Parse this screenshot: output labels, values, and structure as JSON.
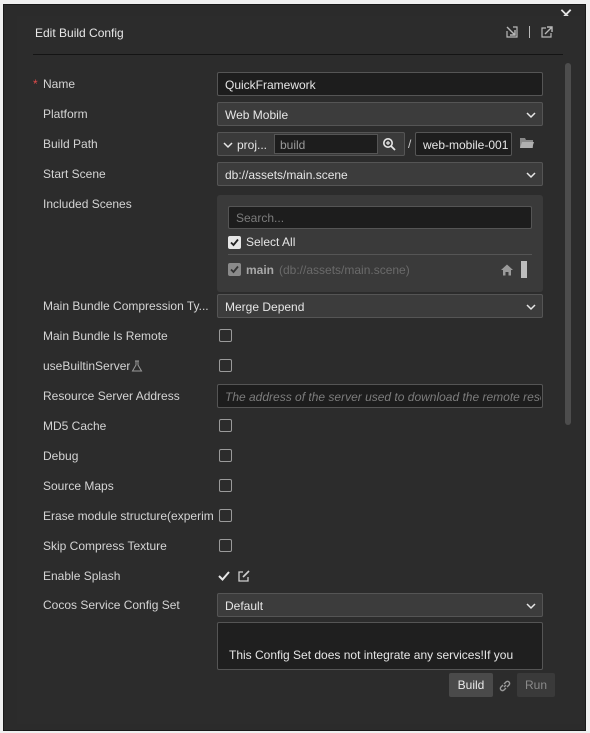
{
  "window": {
    "title": "Edit Build Config"
  },
  "fields": {
    "name": {
      "label": "Name",
      "value": "QuickFramework",
      "required_mark": "*"
    },
    "platform": {
      "label": "Platform",
      "value": "Web Mobile"
    },
    "build_path": {
      "label": "Build Path",
      "prefix": "proj...",
      "folder_value": "build",
      "separator": "/",
      "name_value": "web-mobile-001"
    },
    "start_scene": {
      "label": "Start Scene",
      "value": "db://assets/main.scene"
    },
    "included_scenes": {
      "label": "Included Scenes",
      "search_placeholder": "Search...",
      "select_all_label": "Select All",
      "select_all_checked": true,
      "items": [
        {
          "name": "main",
          "path": "(db://assets/main.scene)",
          "checked": true
        }
      ]
    },
    "main_bundle_compression": {
      "label": "Main Bundle Compression Ty...",
      "value": "Merge Depend"
    },
    "main_bundle_is_remote": {
      "label": "Main Bundle Is Remote",
      "checked": false
    },
    "use_builtin_server": {
      "label": "useBuiltinServer",
      "checked": false
    },
    "resource_server_address": {
      "label": "Resource Server Address",
      "placeholder": "The address of the server used to download the remote resources"
    },
    "md5_cache": {
      "label": "MD5 Cache",
      "checked": false
    },
    "debug": {
      "label": "Debug",
      "checked": false
    },
    "source_maps": {
      "label": "Source Maps",
      "checked": false
    },
    "erase_module_structure": {
      "label": "Erase module structure(experim",
      "checked": false
    },
    "skip_compress_texture": {
      "label": "Skip Compress Texture",
      "checked": false
    },
    "enable_splash": {
      "label": "Enable Splash",
      "checked": true
    },
    "cocos_service_config_set": {
      "label": "Cocos Service Config Set",
      "value": "Default",
      "description": "This Config Set does not integrate any services!If you"
    }
  },
  "buttons": {
    "build": "Build",
    "run": "Run"
  },
  "colors": {
    "background": "#2c2c2c",
    "field": "#3c3c3c",
    "input_dark": "#1d1d1d",
    "required": "#e04b4b"
  }
}
